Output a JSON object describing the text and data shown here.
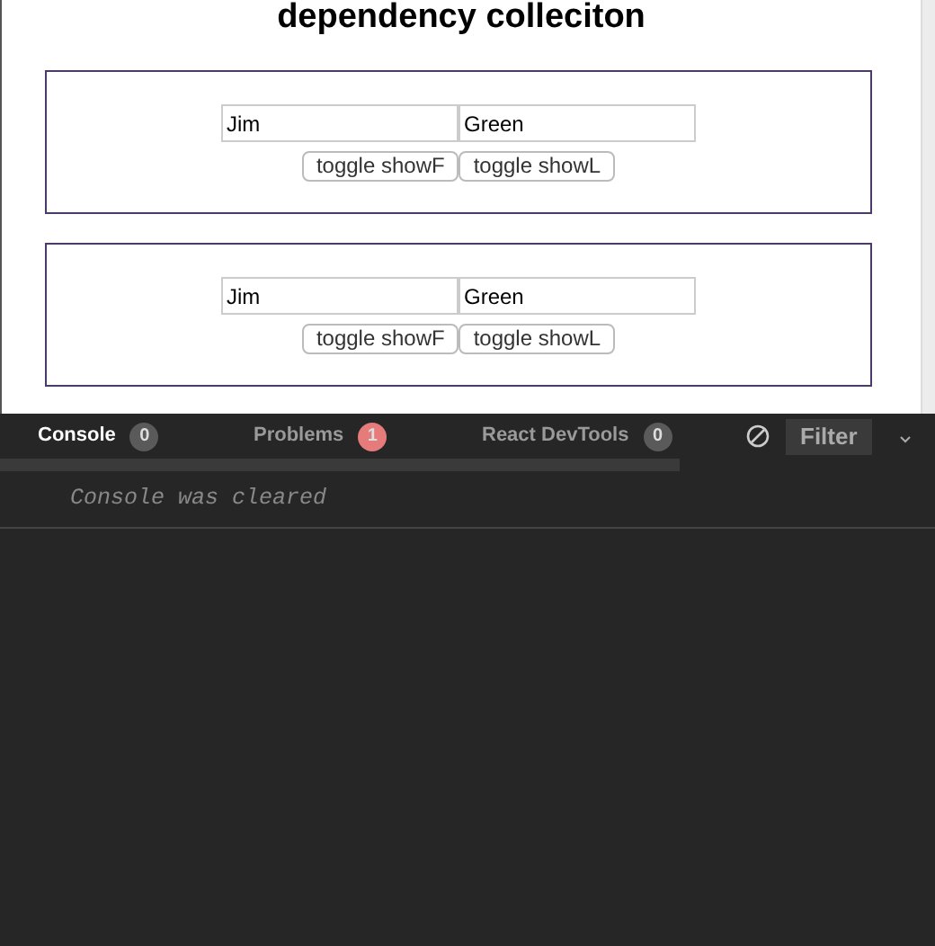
{
  "page": {
    "title": "dependency colleciton"
  },
  "panels": [
    {
      "first_name": "Jim",
      "last_name": "Green",
      "buttons": [
        "toggle showF",
        "toggle showL"
      ]
    },
    {
      "first_name": "Jim",
      "last_name": "Green",
      "buttons": [
        "toggle showF",
        "toggle showL"
      ]
    }
  ],
  "console": {
    "tabs": [
      {
        "label": "Console",
        "count": "0",
        "selected": true,
        "color": "#5a5a5a"
      },
      {
        "label": "Problems",
        "count": "1",
        "selected": false,
        "color": "#e57b7b"
      },
      {
        "label": "React DevTools",
        "count": "0",
        "selected": false,
        "color": "#5a5a5a"
      }
    ],
    "filter_label": "Filter",
    "messages": [
      "Console was cleared"
    ]
  }
}
